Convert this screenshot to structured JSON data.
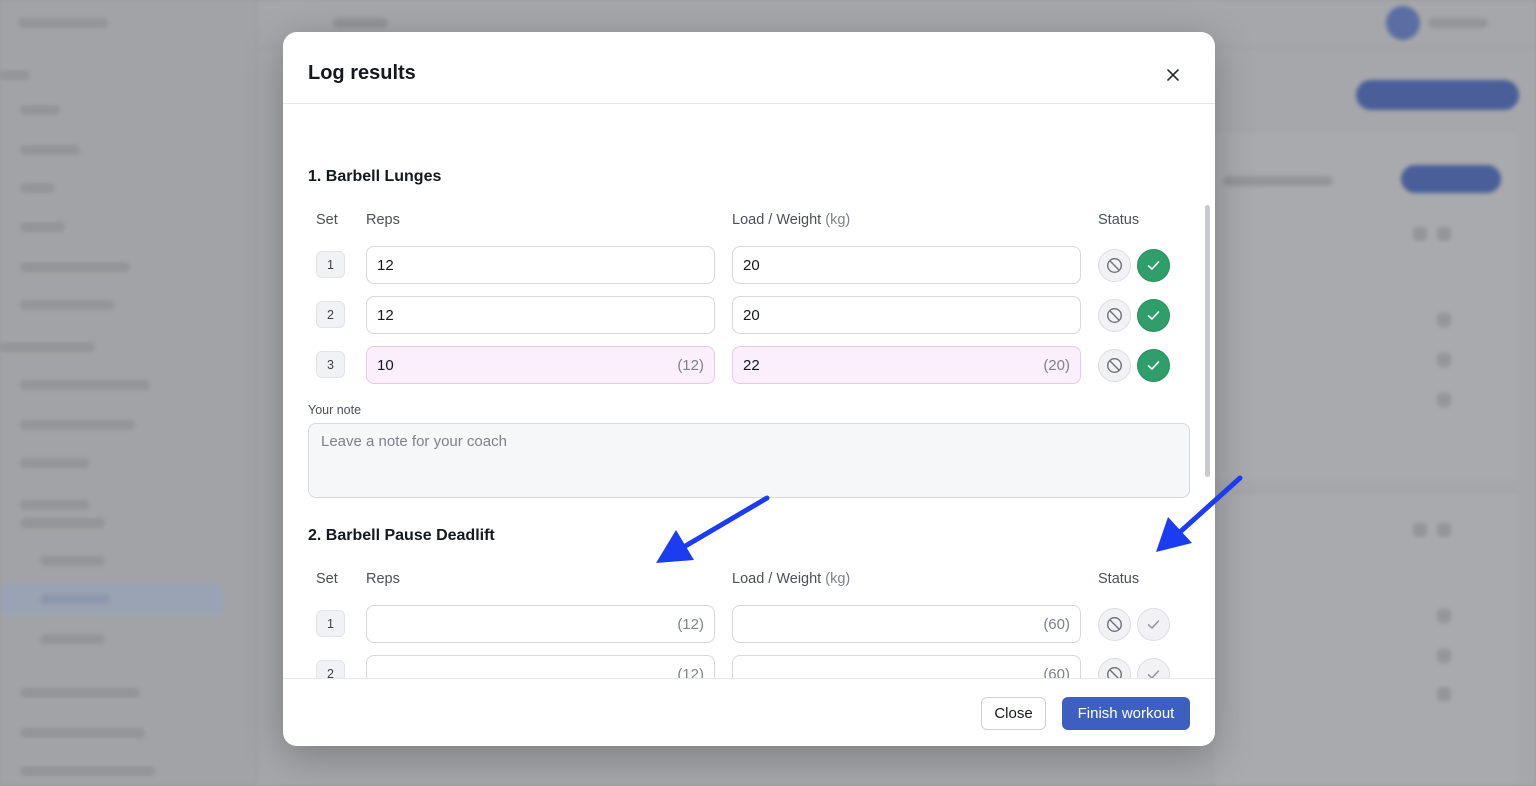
{
  "modal": {
    "title": "Log results",
    "close_icon": "close-icon"
  },
  "exercises": [
    {
      "title": "1. Barbell Lunges",
      "headers": {
        "set": "Set",
        "reps": "Reps",
        "load": "Load / Weight",
        "unit": "(kg)",
        "status": "Status"
      },
      "sets": [
        {
          "set": "1",
          "reps": "12",
          "reps_hint": "",
          "load": "20",
          "load_hint": "",
          "done": true
        },
        {
          "set": "2",
          "reps": "12",
          "reps_hint": "",
          "load": "20",
          "load_hint": "",
          "done": true
        },
        {
          "set": "3",
          "reps": "10",
          "reps_hint": "(12)",
          "load": "22",
          "load_hint": "(20)",
          "done": true
        }
      ],
      "note_label": "Your note",
      "note_placeholder": "Leave a note for your coach"
    },
    {
      "title": "2. Barbell Pause Deadlift",
      "headers": {
        "set": "Set",
        "reps": "Reps",
        "load": "Load / Weight",
        "unit": "(kg)",
        "status": "Status"
      },
      "sets": [
        {
          "set": "1",
          "reps": "",
          "reps_hint": "(12)",
          "load": "",
          "load_hint": "(60)",
          "done": false
        },
        {
          "set": "2",
          "reps": "",
          "reps_hint": "(12)",
          "load": "",
          "load_hint": "(60)",
          "done": false
        }
      ]
    }
  ],
  "footer": {
    "close_label": "Close",
    "finish_label": "Finish workout"
  },
  "colors": {
    "primary": "#3d5fc0",
    "done": "#2f9e6a",
    "changed_bg": "#fbeffd",
    "annotation_arrow": "#1b3cf0"
  },
  "icons": {
    "skip": "ban-icon",
    "done": "check-icon"
  }
}
